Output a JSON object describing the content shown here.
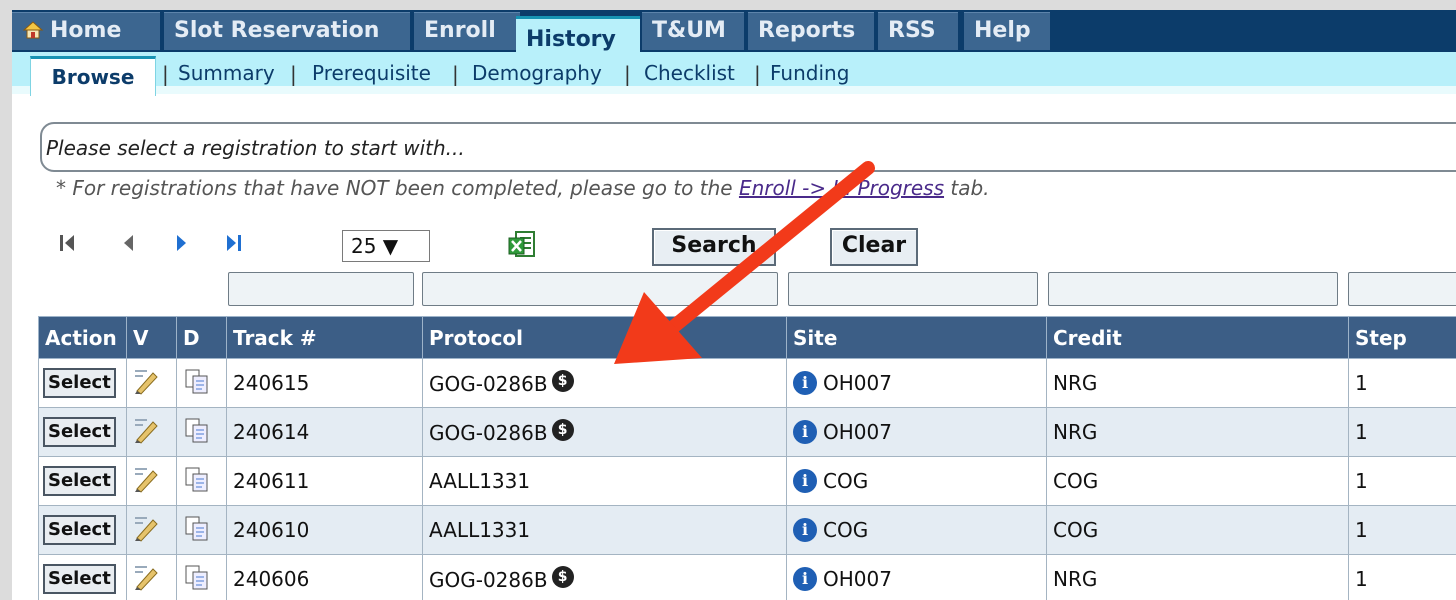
{
  "nav": {
    "home": "Home",
    "tabs": [
      "Slot Reservation",
      "Enroll",
      "History",
      "T&UM",
      "Reports",
      "RSS",
      "Help"
    ],
    "active_tab": "History"
  },
  "subnav": {
    "active": "Browse",
    "items": [
      "Summary",
      "Prerequisite",
      "Demography",
      "Checklist",
      "Funding"
    ]
  },
  "registration_select": {
    "placeholder": "Please select a registration to start with..."
  },
  "note": {
    "prefix": "* For registrations that have NOT been completed, please go to the ",
    "link": "Enroll -> In Progress",
    "suffix": " tab."
  },
  "toolbar": {
    "page_size": "25 ▼",
    "search": "Search",
    "clear": "Clear"
  },
  "grid": {
    "headers": [
      "Action",
      "V",
      "D",
      "Track #",
      "Protocol",
      "Site",
      "Credit",
      "Step"
    ],
    "rows": [
      {
        "action": "Select",
        "track": "240615",
        "protocol": "GOG-0286B",
        "coin": "$",
        "site": "OH007",
        "credit": "NRG",
        "step": "1"
      },
      {
        "action": "Select",
        "track": "240614",
        "protocol": "GOG-0286B",
        "coin": "$",
        "site": "OH007",
        "credit": "NRG",
        "step": "1"
      },
      {
        "action": "Select",
        "track": "240611",
        "protocol": "AALL1331",
        "coin": "",
        "site": "COG",
        "credit": "COG",
        "step": "1"
      },
      {
        "action": "Select",
        "track": "240610",
        "protocol": "AALL1331",
        "coin": "",
        "site": "COG",
        "credit": "COG",
        "step": "1"
      },
      {
        "action": "Select",
        "track": "240606",
        "protocol": "GOG-0286B",
        "coin": "$",
        "site": "OH007",
        "credit": "NRG",
        "step": "1"
      }
    ]
  },
  "icons": {
    "home": "home-icon",
    "first": "first-page-icon",
    "prev": "prev-page-icon",
    "next": "next-page-icon",
    "last": "last-page-icon",
    "excel": "excel-export-icon",
    "view": "view-pen-icon",
    "doc": "document-copy-icon",
    "coin": "dollar-coin-icon",
    "info": "info-icon",
    "arrow": "red-arrow-annotation"
  },
  "colors": {
    "nav_bg": "#0c3c6a",
    "tab_bg": "#3c6690",
    "subnav_bg": "#b8f0fa",
    "header_bg": "#3c5e86",
    "row_alt": "#e4ecf3",
    "arrow": "#f23a1a"
  }
}
